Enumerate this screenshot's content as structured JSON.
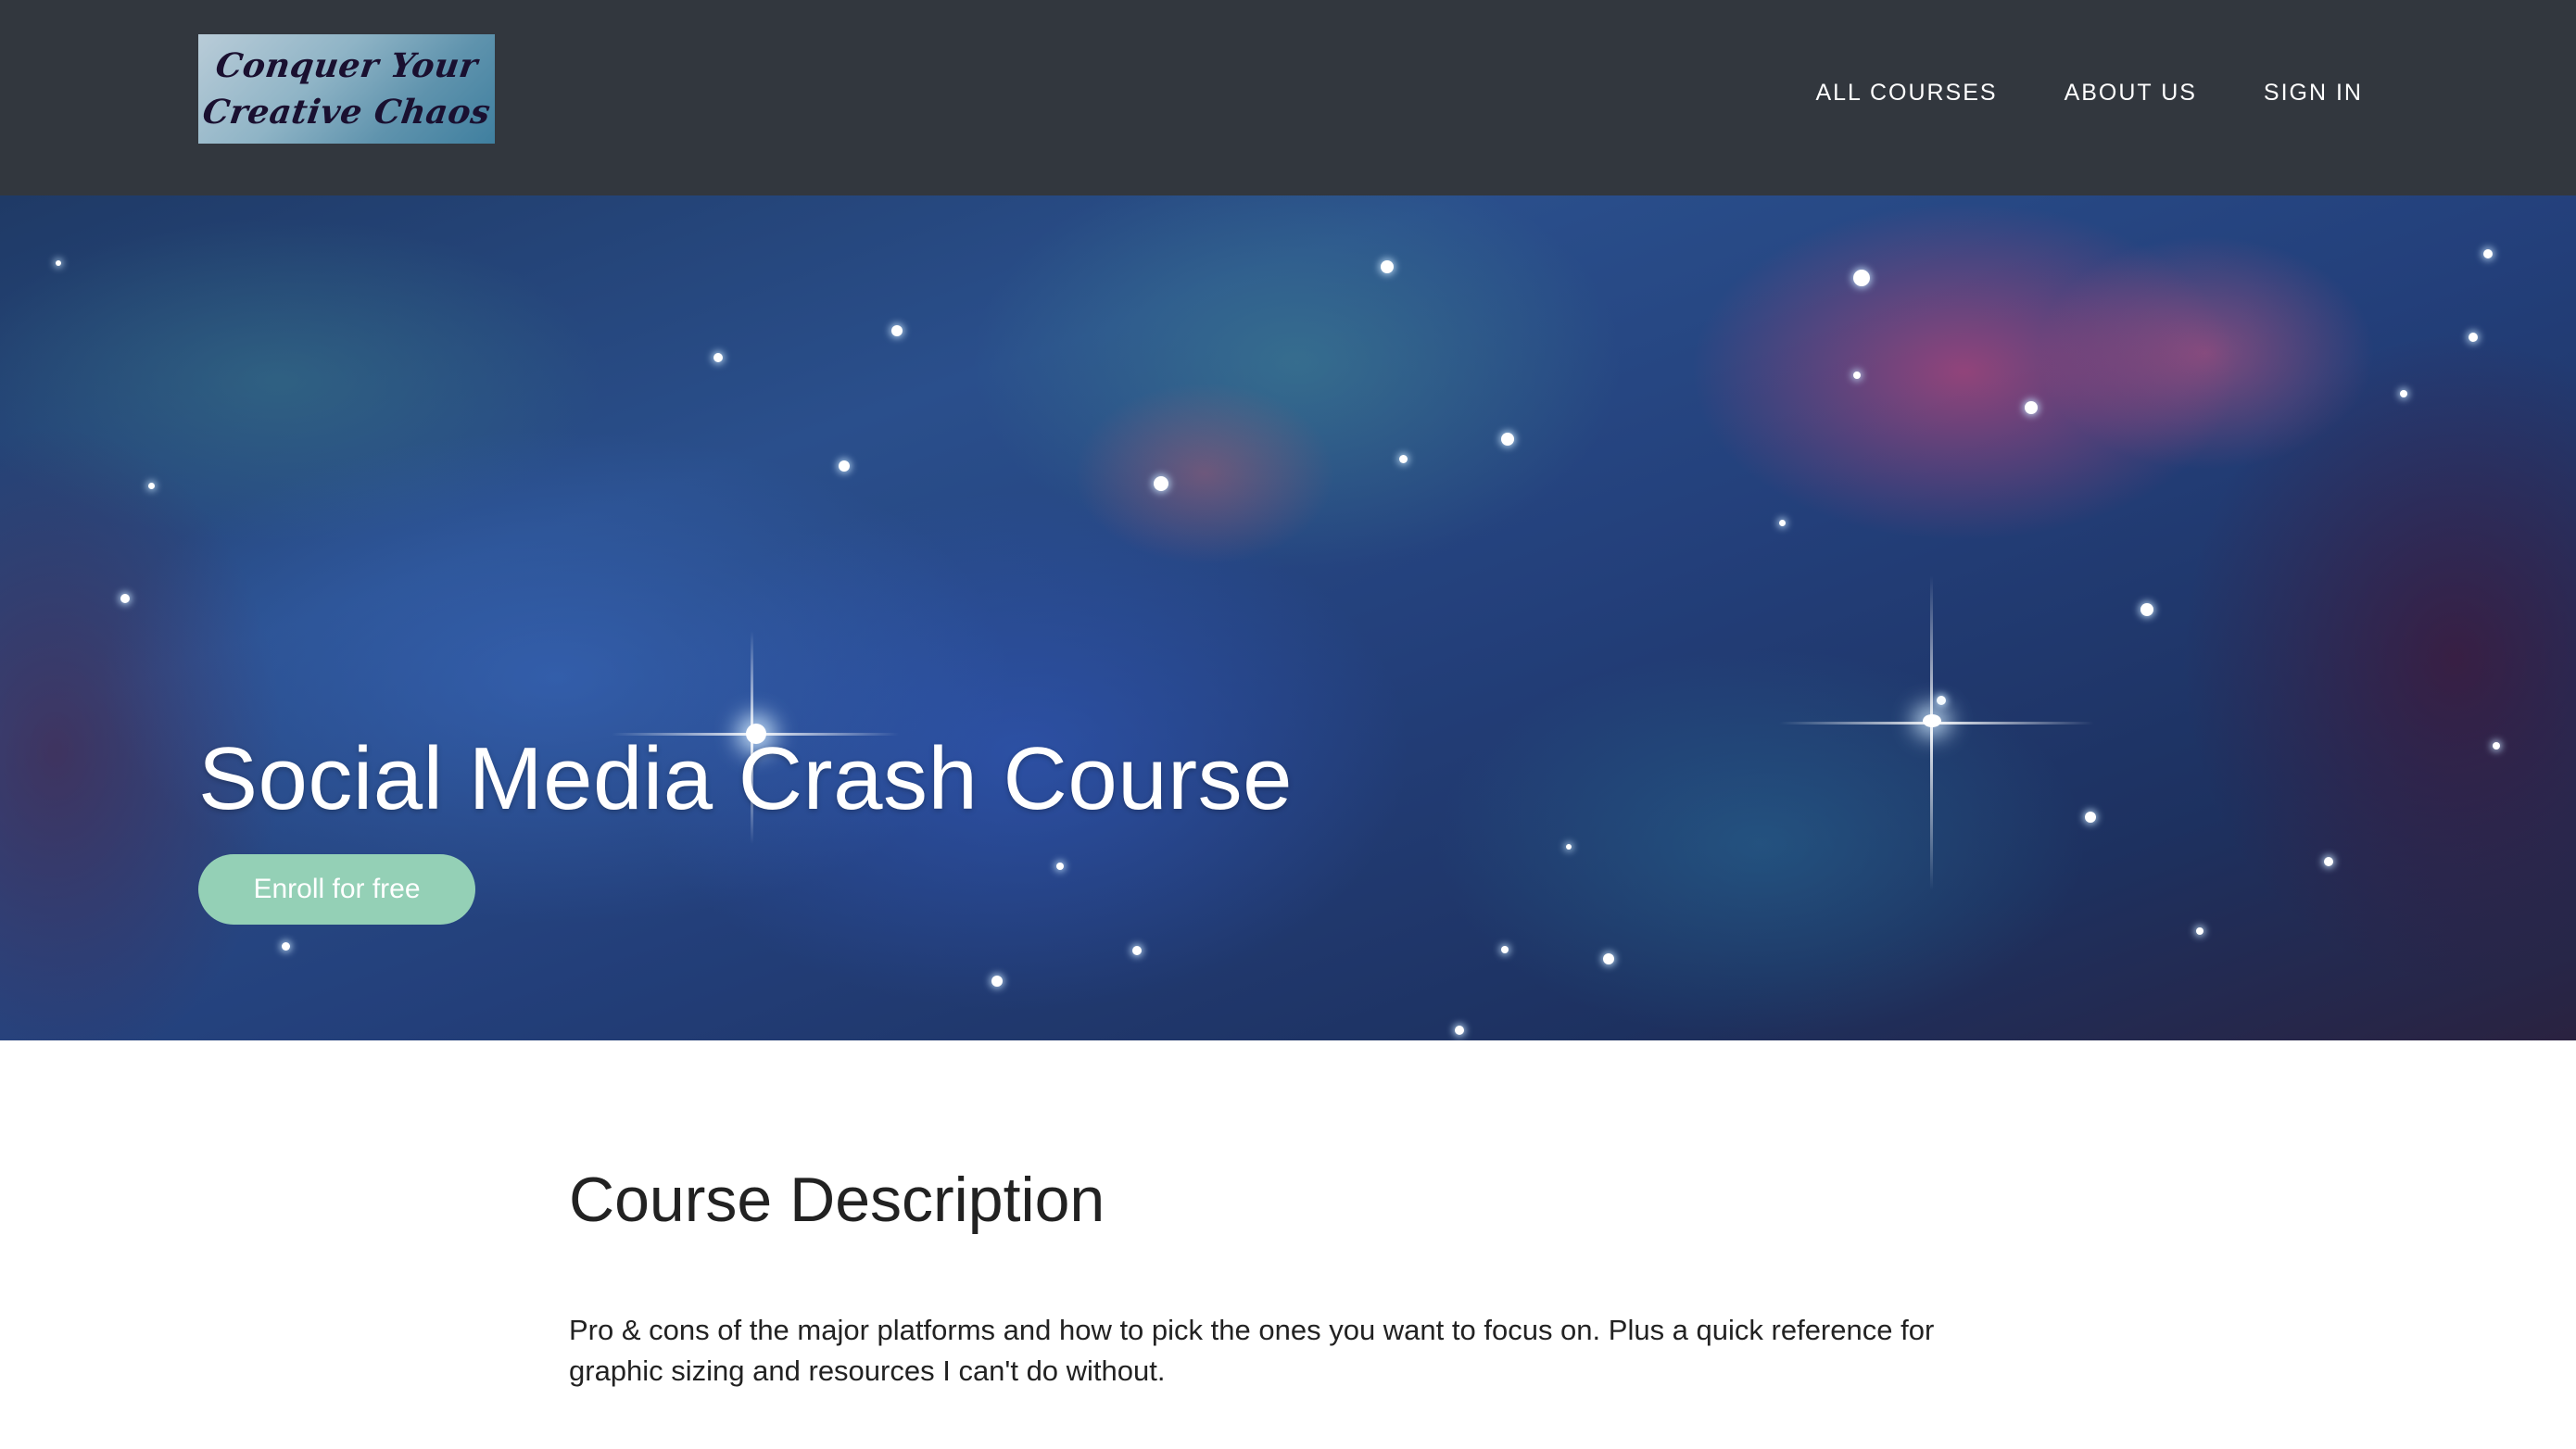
{
  "header": {
    "logo_line1": "Conquer Your",
    "logo_line2": "Creative Chaos",
    "nav": [
      {
        "label": "ALL COURSES"
      },
      {
        "label": "ABOUT US"
      },
      {
        "label": "SIGN IN"
      }
    ]
  },
  "hero": {
    "title": "Social Media Crash Course",
    "enroll_label": "Enroll for free"
  },
  "description": {
    "heading": "Course Description",
    "body": "Pro & cons of the major platforms and how to pick the ones you want to focus on. Plus a quick reference for graphic sizing and resources I can't do without."
  },
  "colors": {
    "header_bg": "#32373e",
    "button_bg": "#94d0b6",
    "text": "#222222"
  }
}
